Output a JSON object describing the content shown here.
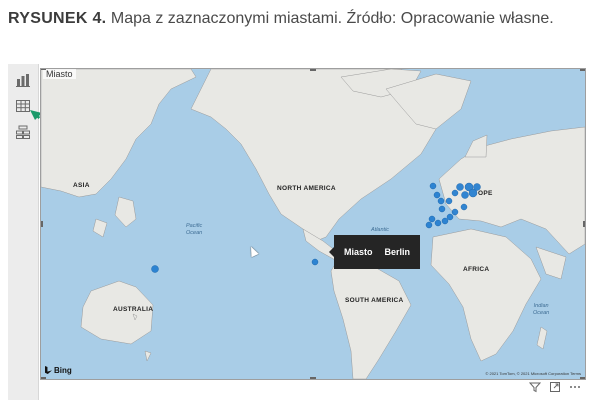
{
  "caption": {
    "figure": "RYSUNEK 4.",
    "text": "Mapa z zaznaczonymi miastami. Źródło: Opracowanie własne."
  },
  "visualizations_pane": {
    "icons": [
      "bar-chart-icon",
      "table-icon",
      "field-list-icon"
    ],
    "selected": "table-icon"
  },
  "visual": {
    "title": "Miasto",
    "map_labels": {
      "asia": "ASIA",
      "north_america": "NORTH AMERICA",
      "europe": "OPE",
      "africa": "AFRICA",
      "south_america": "SOUTH AMERICA",
      "australia": "AUSTRALIA"
    },
    "ocean_labels": {
      "pacific": "Pacific\nOcean",
      "atlantic": "Atlantic",
      "indian": "Indian\nOcean"
    },
    "bing": "Bing",
    "copyright": "© 2021 TomTom, © 2021 Microsoft Corporation Terms"
  },
  "tooltip": {
    "field": "Miasto",
    "value": "Berlin"
  },
  "colors": {
    "ocean": "#a8cde8",
    "land": "#e9e9e6",
    "marker": "#1f7bd0",
    "tooltip_bg": "#252525",
    "arrow": "#1a9a6a"
  },
  "visual_footer_icons": [
    "filter-icon",
    "focus-mode-icon",
    "more-options-icon"
  ]
}
